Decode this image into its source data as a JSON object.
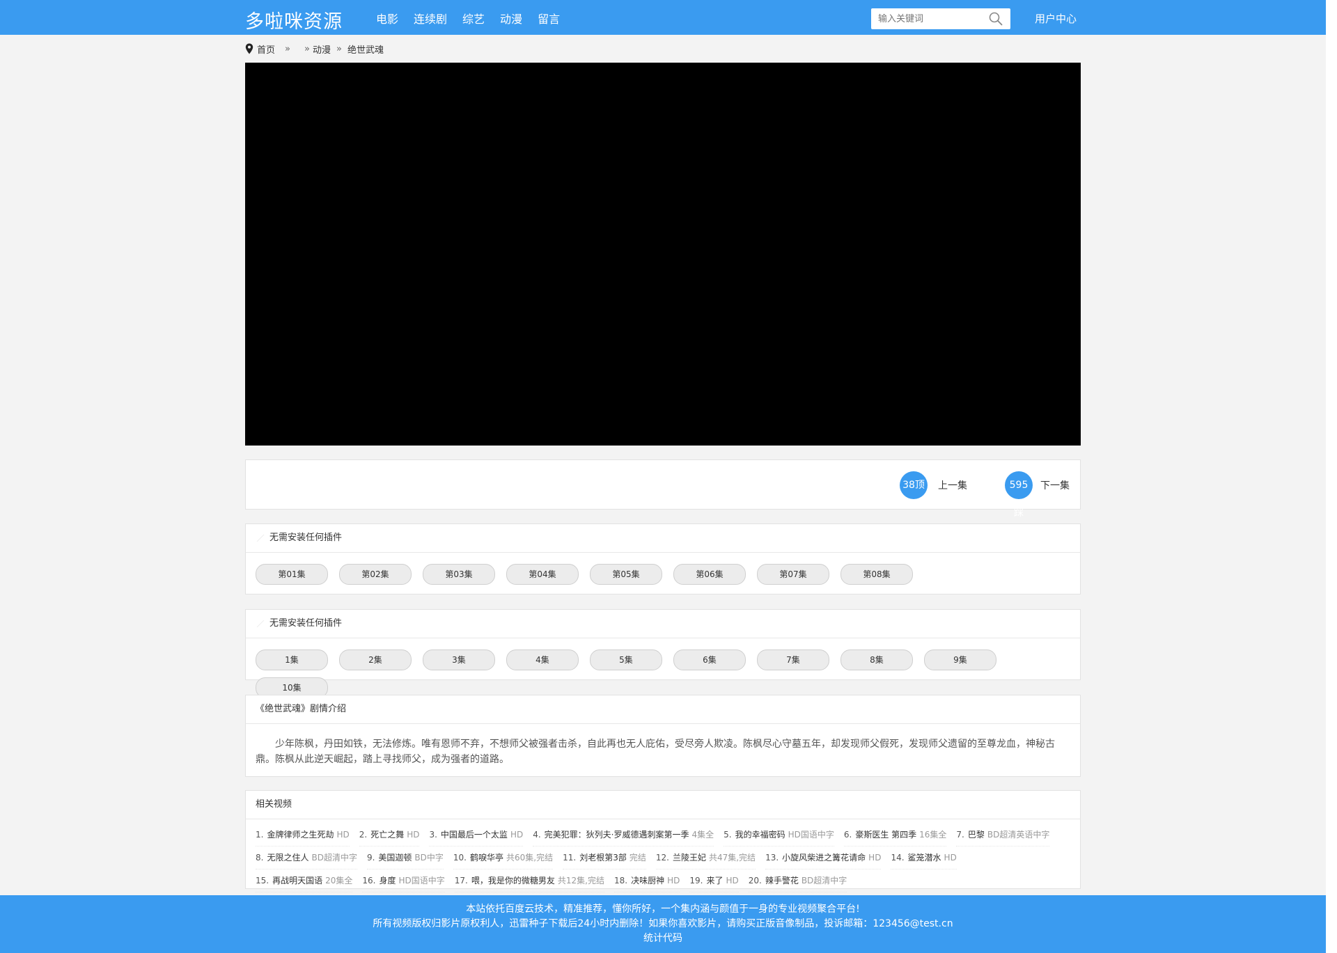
{
  "header": {
    "logo": "多啦咪资源",
    "nav": [
      "电影",
      "连续剧",
      "综艺",
      "动漫",
      "留言"
    ],
    "search_placeholder": "输入关键词",
    "user_center": "用户中心"
  },
  "breadcrumb": {
    "home": "首页",
    "sep1": "»",
    "sep2": "»",
    "category": "动漫",
    "sep3": "»",
    "current": "绝世武魂"
  },
  "controls": {
    "up_count": "38顶",
    "prev_label": "上一集",
    "down_count": "595踩",
    "next_label": "下一集"
  },
  "source1": {
    "title": "无需安装任何插件",
    "episodes": [
      "第01集",
      "第02集",
      "第03集",
      "第04集",
      "第05集",
      "第06集",
      "第07集",
      "第08集"
    ]
  },
  "source2": {
    "title": "无需安装任何插件",
    "episodes": [
      "1集",
      "2集",
      "3集",
      "4集",
      "5集",
      "6集",
      "7集",
      "8集",
      "9集",
      "10集"
    ]
  },
  "description": {
    "title": "《绝世武魂》剧情介绍",
    "text": "少年陈枫，丹田如铁，无法修炼。唯有恩师不弃，不想师父被强者击杀，自此再也无人庇佑，受尽旁人欺凌。陈枫尽心守墓五年，却发现师父假死，发现师父遗留的至尊龙血，神秘古鼎。陈枫从此逆天崛起，踏上寻找师父，成为强者的道路。"
  },
  "related": {
    "title": "相关视频",
    "items": [
      {
        "num": "1.",
        "title": "金牌律师之生死劫",
        "tag": "HD"
      },
      {
        "num": "2.",
        "title": "死亡之舞",
        "tag": "HD"
      },
      {
        "num": "3.",
        "title": "中国最后一个太监",
        "tag": "HD"
      },
      {
        "num": "4.",
        "title": "完美犯罪：狄列夫·罗威德遇刺案第一季",
        "tag": "4集全"
      },
      {
        "num": "5.",
        "title": "我的幸福密码",
        "tag": "HD国语中字"
      },
      {
        "num": "6.",
        "title": "豪斯医生 第四季",
        "tag": "16集全"
      },
      {
        "num": "7.",
        "title": "巴黎",
        "tag": "BD超清英语中字"
      },
      {
        "num": "8.",
        "title": "无限之住人",
        "tag": "BD超清中字"
      },
      {
        "num": "9.",
        "title": "美国迦顿",
        "tag": "BD中字"
      },
      {
        "num": "10.",
        "title": "鹤唳华亭",
        "tag": "共60集,完结"
      },
      {
        "num": "11.",
        "title": "刘老根第3部",
        "tag": "完结"
      },
      {
        "num": "12.",
        "title": "兰陵王妃",
        "tag": "共47集,完结"
      },
      {
        "num": "13.",
        "title": "小旋风柴进之篝花请命",
        "tag": "HD"
      },
      {
        "num": "14.",
        "title": "鲨笼潜水",
        "tag": "HD"
      },
      {
        "num": "15.",
        "title": "再战明天国语",
        "tag": "20集全"
      },
      {
        "num": "16.",
        "title": "身度",
        "tag": "HD国语中字"
      },
      {
        "num": "17.",
        "title": "喂，我是你的微糖男友",
        "tag": "共12集,完结"
      },
      {
        "num": "18.",
        "title": "决味厨神",
        "tag": "HD"
      },
      {
        "num": "19.",
        "title": "来了",
        "tag": "HD"
      },
      {
        "num": "20.",
        "title": "辣手警花",
        "tag": "BD超清中字"
      }
    ]
  },
  "footer": {
    "line1": "本站依托百度云技术，精准推荐，懂你所好，一个集内涵与颜值于一身的专业视频聚合平台!",
    "line2": "所有视频版权归影片原权利人，迅雷种子下载后24小时内删除！如果你喜欢影片，请购买正版音像制品，投诉邮箱：123456@test.cn",
    "line3": "统计代码"
  },
  "colors": {
    "brand_blue": "#3a9bf0",
    "player_bg": "#000000"
  }
}
